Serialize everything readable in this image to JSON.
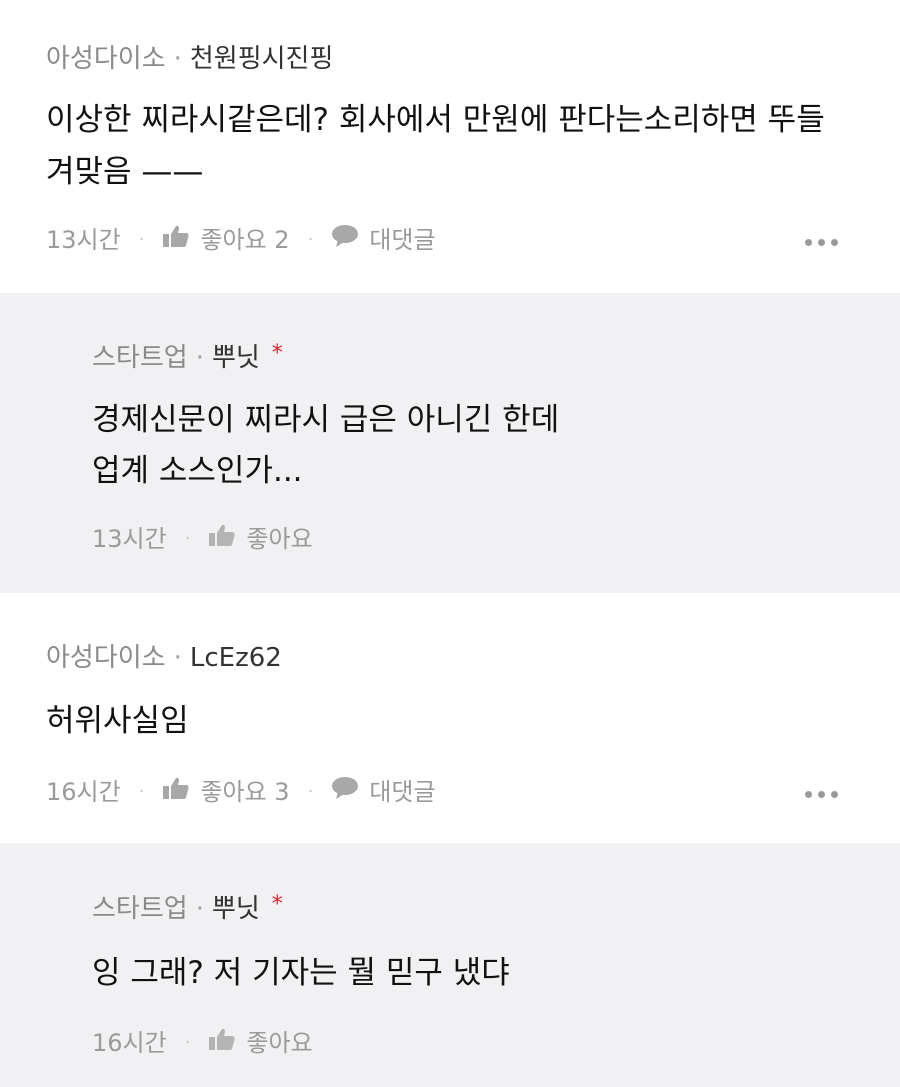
{
  "comments": [
    {
      "company": "아성다이소",
      "author": "천원핑시진핑",
      "text_lines": [
        "이상한 찌라시같은데? 회사에서 만원에 판다는소리하면 뚜들",
        "겨맞음 ——"
      ],
      "time": "13시간",
      "like_label": "좋아요 2",
      "reply_label": "대댓글"
    },
    {
      "company": "스타트업",
      "author": "뿌닛",
      "star": "*",
      "text_lines": [
        "경제신문이 찌라시 급은 아니긴 한데",
        "업계 소스인가..."
      ],
      "time": "13시간",
      "like_label": "좋아요"
    },
    {
      "company": "아성다이소",
      "author": "LcEz62",
      "text_lines": [
        "허위사실임"
      ],
      "time": "16시간",
      "like_label": "좋아요 3",
      "reply_label": "대댓글"
    },
    {
      "company": "스타트업",
      "author": "뿌닛",
      "star": "*",
      "text_lines": [
        "잉 그래? 저 기자는 뭘 믿구 냈댜"
      ],
      "time": "16시간",
      "like_label": "좋아요"
    }
  ],
  "separator": "·",
  "icons": {
    "like": "thumbs-up-icon",
    "reply": "speech-bubble-icon",
    "more": "more-dots-icon"
  },
  "colors": {
    "reply_background": "#f1f1f3",
    "meta_gray": "#8a8a8a",
    "star_red": "#e0242d"
  }
}
